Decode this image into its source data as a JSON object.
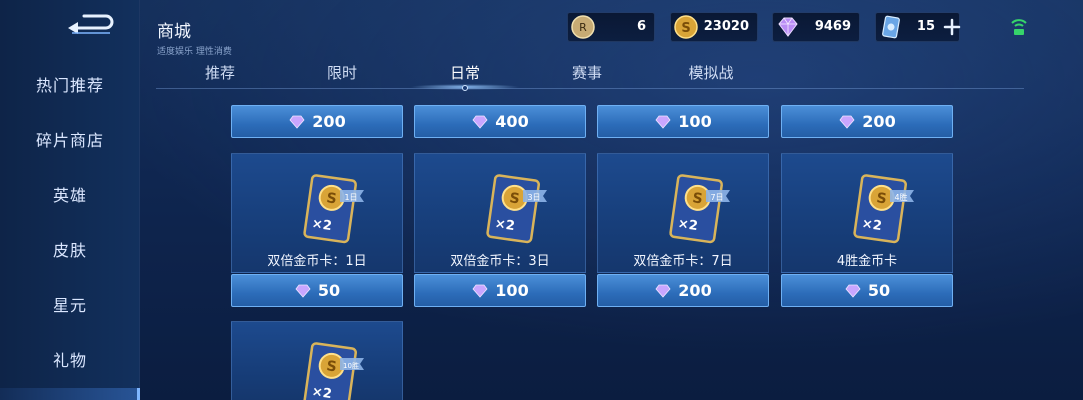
{
  "header": {
    "title": "商城",
    "subtitle": "适度娱乐 理性消费"
  },
  "sidebar": {
    "items": [
      {
        "label": "热门推荐"
      },
      {
        "label": "碎片商店"
      },
      {
        "label": "英雄"
      },
      {
        "label": "皮肤"
      },
      {
        "label": "星元"
      },
      {
        "label": "礼物"
      }
    ]
  },
  "currencies": [
    {
      "icon": "coupon-icon",
      "value": "6"
    },
    {
      "icon": "gold-coin-icon",
      "value": "23020"
    },
    {
      "icon": "diamond-icon",
      "value": "9469"
    },
    {
      "icon": "card-ticket-icon",
      "value": "15"
    }
  ],
  "tabs": [
    {
      "label": "推荐"
    },
    {
      "label": "限时"
    },
    {
      "label": "日常"
    },
    {
      "label": "赛事"
    },
    {
      "label": "模拟战"
    }
  ],
  "active_tab": "日常",
  "top_prices": [
    "200",
    "400",
    "100",
    "200"
  ],
  "items": [
    {
      "name": "双倍金币卡：1日",
      "badge": "1日",
      "multiplier": "×2",
      "price": "50"
    },
    {
      "name": "双倍金币卡：3日",
      "badge": "3日",
      "multiplier": "×2",
      "price": "100"
    },
    {
      "name": "双倍金币卡：7日",
      "badge": "7日",
      "multiplier": "×2",
      "price": "200"
    },
    {
      "name": "4胜金币卡",
      "badge": "4胜",
      "multiplier": "×2",
      "price": "50"
    },
    {
      "name": "",
      "badge": "10胜",
      "multiplier": "×2",
      "price": ""
    }
  ],
  "colors": {
    "accent": "#4b8fd8",
    "gold": "#e0b24a",
    "diamond": "#c9a6ff"
  }
}
